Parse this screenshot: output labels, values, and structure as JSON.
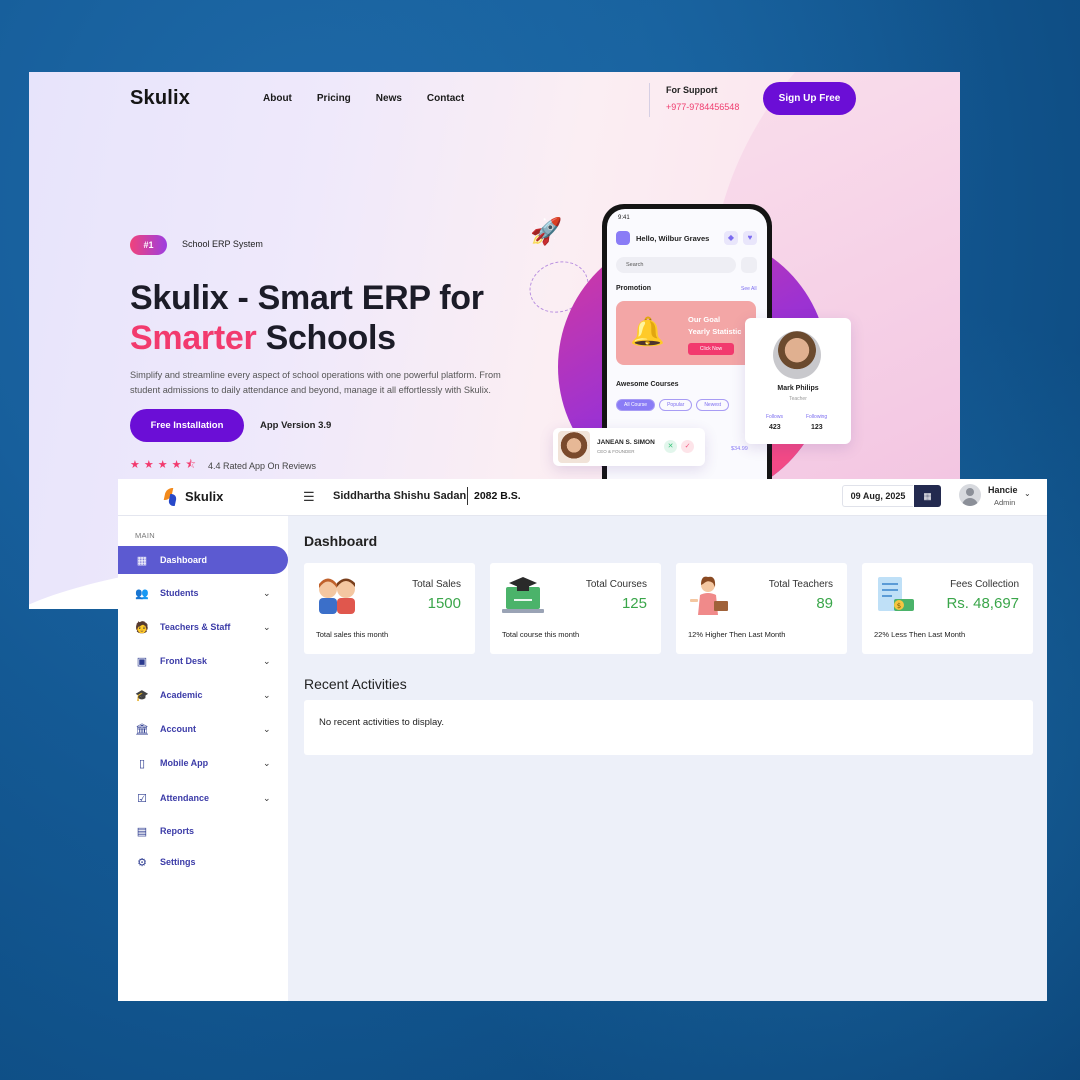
{
  "landing": {
    "brand": "Skulix",
    "nav": [
      "About",
      "Pricing",
      "News",
      "Contact"
    ],
    "support_label": "For Support",
    "support_phone": "+977-9784456548",
    "signup_label": "Sign Up Free",
    "rank_badge": "#1",
    "rank_text": "School ERP System",
    "hero_line1": "Skulix - Smart ERP for",
    "hero_accent": "Smarter",
    "hero_line2_rest": " Schools",
    "description": "Simplify and streamline every aspect of school operations with one powerful platform. From student admissions to daily attendance and beyond, manage it all effortlessly with Skulix.",
    "install_label": "Free Installation",
    "app_version": "App Version 3.9",
    "rating_stars": 4.5,
    "rating_text": "4.4 Rated App On Reviews",
    "phone": {
      "time": "9:41",
      "greeting": "Hello, Wilbur Graves",
      "search_placeholder": "Search",
      "promotion": "Promotion",
      "see_all": "See All",
      "goal_line1": "Our Goal",
      "goal_line2": "Yearly Statistic",
      "click_now": "Click Now",
      "awesome_courses": "Awesome Courses",
      "chips": [
        "All Course",
        "Popular",
        "Newest"
      ],
      "price": "$34.99"
    },
    "profile_card": {
      "name": "Mark Philips",
      "role": "Teacher",
      "follows_label": "Follows",
      "follows_value": "423",
      "following_label": "Following",
      "following_value": "123"
    },
    "janean_card": {
      "name": "JANEAN S. SIMON",
      "role": "CEO & FOUNDER"
    },
    "colors": {
      "primary": "#6b0ed6",
      "accent": "#f23a6e"
    }
  },
  "admin": {
    "brand": "Skulix",
    "school_name": "Siddhartha Shishu Sadan",
    "year": "2082 B.S.",
    "date": "09 Aug, 2025",
    "user_name": "Hancie",
    "user_role": "Admin",
    "sidebar_section": "MAIN",
    "sidebar_items": [
      {
        "label": "Dashboard",
        "icon": "dashboard-icon",
        "expandable": false,
        "active": true
      },
      {
        "label": "Students",
        "icon": "students-icon",
        "expandable": true
      },
      {
        "label": "Teachers & Staff",
        "icon": "teacher-icon",
        "expandable": true
      },
      {
        "label": "Front Desk",
        "icon": "front-desk-icon",
        "expandable": true
      },
      {
        "label": "Academic",
        "icon": "graduation-cap-icon",
        "expandable": true
      },
      {
        "label": "Account",
        "icon": "bank-icon",
        "expandable": true
      },
      {
        "label": "Mobile App",
        "icon": "mobile-icon",
        "expandable": true
      },
      {
        "label": "Attendance",
        "icon": "attendance-icon",
        "expandable": true
      },
      {
        "label": "Reports",
        "icon": "reports-icon",
        "expandable": false
      },
      {
        "label": "Settings",
        "icon": "gear-icon",
        "expandable": false
      }
    ],
    "page_title": "Dashboard",
    "stats": [
      {
        "title": "Total Sales",
        "value": "1500",
        "subtitle": "Total sales this month",
        "icon": "students-illustration-icon"
      },
      {
        "title": "Total Courses",
        "value": "125",
        "subtitle": "Total course this month",
        "icon": "laptop-graduation-icon"
      },
      {
        "title": "Total Teachers",
        "value": "89",
        "subtitle": "12% Higher Then Last Month",
        "icon": "teacher-illustration-icon"
      },
      {
        "title": "Fees Collection",
        "value": "Rs. 48,697",
        "subtitle": "22% Less Then Last Month",
        "icon": "fees-illustration-icon"
      }
    ],
    "recent_title": "Recent Activities",
    "recent_empty": "No recent activities to display.",
    "colors": {
      "active_sidebar": "#5c5ad1",
      "stat_value": "#3aa64a",
      "calendar_button": "#232a4f"
    }
  }
}
